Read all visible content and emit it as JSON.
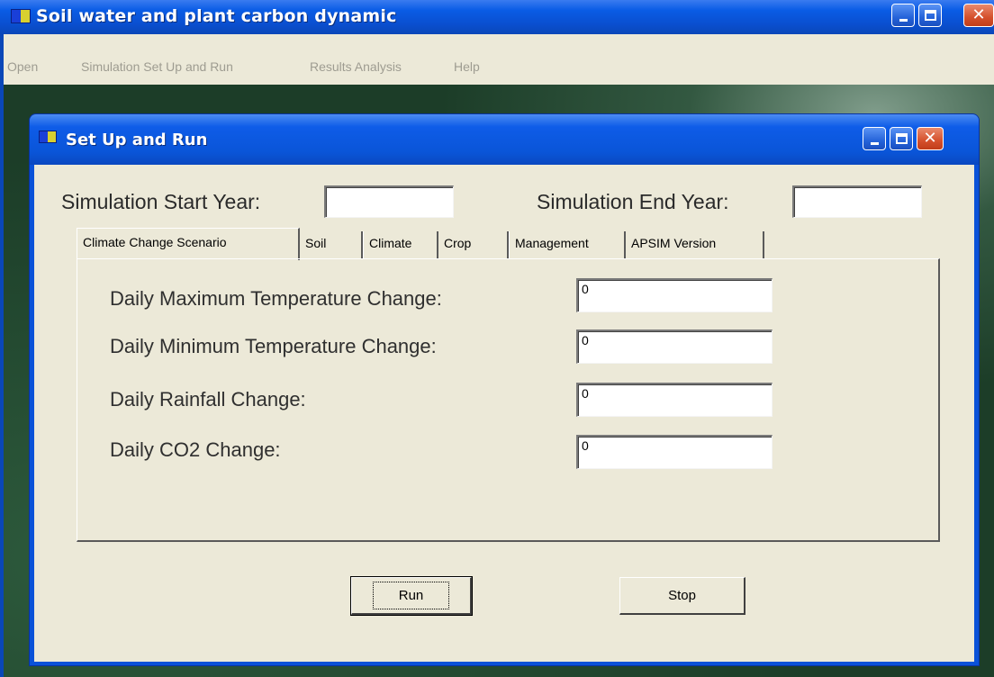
{
  "main_window": {
    "title": "Soil water and plant carbon dynamic",
    "menu": [
      "Open",
      "Simulation Set Up and Run",
      "Results Analysis",
      "Help"
    ]
  },
  "dialog": {
    "title": "Set Up and Run",
    "start_year_label": "Simulation Start Year:",
    "start_year_value": "",
    "end_year_label": "Simulation End Year:",
    "end_year_value": "",
    "tabs": [
      "Climate Change Scenario",
      "Soil",
      "Climate",
      "Crop",
      "Management",
      "APSIM Version"
    ],
    "active_tab": "Climate Change Scenario",
    "fields": [
      {
        "label": "Daily Maximum Temperature Change:",
        "value": "0"
      },
      {
        "label": "Daily Minimum  Temperature Change:",
        "value": "0"
      },
      {
        "label": "Daily Rainfall Change:",
        "value": "0"
      },
      {
        "label": "Daily CO2 Change:",
        "value": "0"
      }
    ],
    "run_label": "Run",
    "stop_label": "Stop"
  },
  "icons": [
    "app-icon",
    "minimize-icon",
    "maximize-icon",
    "close-icon"
  ],
  "colors": {
    "titlebar": "#0a55d8",
    "close": "#d5502c",
    "face": "#ece9d8"
  }
}
